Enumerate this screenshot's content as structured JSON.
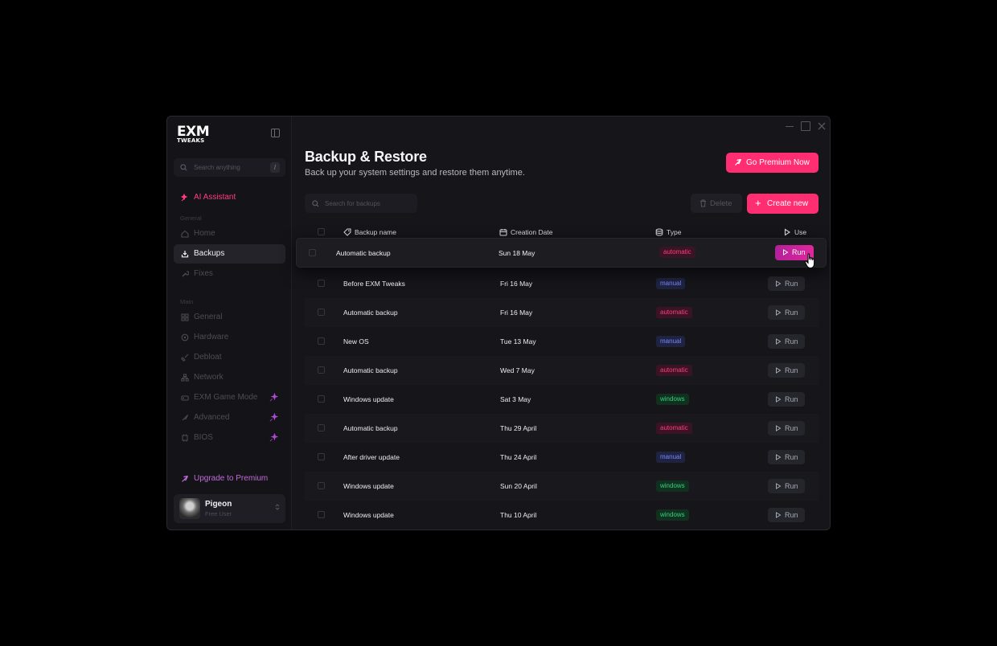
{
  "brand": {
    "logo_line1": "EXM",
    "logo_line2": "TWEAKS"
  },
  "sidebar": {
    "search_placeholder": "Search anything",
    "search_shortcut": "/",
    "ai_assistant": "AI Assistant",
    "section_general": "General",
    "section_main": "Main",
    "items": [
      {
        "label": "Home",
        "icon": "home-icon"
      },
      {
        "label": "Backups",
        "icon": "backup-icon"
      },
      {
        "label": "Fixes",
        "icon": "wrench-icon"
      },
      {
        "label": "General",
        "icon": "grid-icon"
      },
      {
        "label": "Hardware",
        "icon": "cpu-icon"
      },
      {
        "label": "Debloat",
        "icon": "broom-icon"
      },
      {
        "label": "Network",
        "icon": "network-icon"
      },
      {
        "label": "EXM Game Mode",
        "icon": "gamepad-icon"
      },
      {
        "label": "Advanced",
        "icon": "rocket-icon"
      },
      {
        "label": "BIOS",
        "icon": "chip-icon"
      }
    ],
    "active_item": "Backups",
    "upgrade": "Upgrade to Premium",
    "user": {
      "name": "Pigeon",
      "plan": "Free User"
    }
  },
  "header": {
    "title": "Backup & Restore",
    "subtitle": "Back up your system settings and restore them anytime.",
    "premium_button": "Go Premium Now"
  },
  "toolbar": {
    "search_placeholder": "Search for backups",
    "delete_label": "Delete",
    "create_label": "Create new"
  },
  "table": {
    "columns": {
      "name": "Backup name",
      "date": "Creation Date",
      "type": "Type",
      "use": "Use"
    },
    "run_label": "Run",
    "hovered_row": {
      "name": "Automatic backup",
      "date": "Sun 18 May",
      "type": "automatic"
    },
    "rows": [
      {
        "name": "Before EXM Tweaks",
        "date": "Fri 16 May",
        "type": "manual"
      },
      {
        "name": "Automatic backup",
        "date": "Fri 16 May",
        "type": "automatic"
      },
      {
        "name": "New OS",
        "date": "Tue 13 May",
        "type": "manual"
      },
      {
        "name": "Automatic backup",
        "date": "Wed 7 May",
        "type": "automatic"
      },
      {
        "name": "Windows update",
        "date": "Sat 3 May",
        "type": "windows"
      },
      {
        "name": "Automatic backup",
        "date": "Thu 29 April",
        "type": "automatic"
      },
      {
        "name": "After driver update",
        "date": "Thu 24 April",
        "type": "manual"
      },
      {
        "name": "Windows update",
        "date": "Sun 20 April",
        "type": "windows"
      },
      {
        "name": "Windows update",
        "date": "Thu 10 April",
        "type": "windows"
      }
    ]
  },
  "colors": {
    "accent": "#ff2e73",
    "manual": "#7b86ff",
    "automatic": "#ff3d78",
    "windows": "#34d27a"
  }
}
